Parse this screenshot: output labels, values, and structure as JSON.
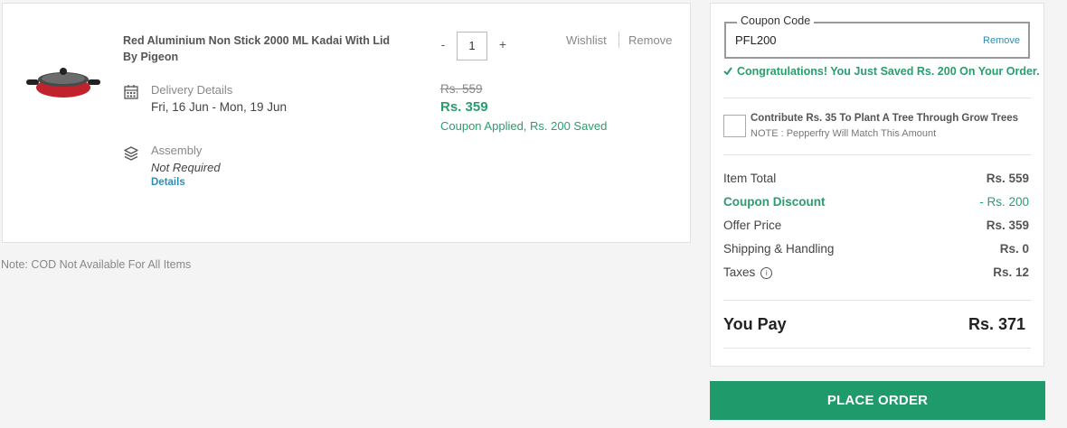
{
  "cart_item": {
    "name": "Red Aluminium Non Stick 2000 ML Kadai With Lid By Pigeon",
    "delivery_label": "Delivery Details",
    "delivery_value": "Fri, 16 Jun - Mon, 19 Jun",
    "assembly_label": "Assembly",
    "assembly_value": "Not Required",
    "assembly_link": "Details",
    "qty_minus": "-",
    "quantity": "1",
    "qty_plus": "+",
    "wishlist": "Wishlist",
    "remove": "Remove",
    "price_original": "Rs. 559",
    "price_final": "Rs. 359",
    "price_note": "Coupon Applied, Rs. 200 Saved",
    "product_colors": {
      "body": "#c0232b",
      "lid": "#3a3a3a",
      "handle": "#222222"
    }
  },
  "note": "Note: COD Not Available For All Items",
  "summary": {
    "coupon_legend": "Coupon Code",
    "coupon_value": "PFL200",
    "coupon_remove": "Remove",
    "coupon_message": "Congratulations! You Just Saved Rs. 200 On Your Order.",
    "tree_text": "Contribute Rs. 35 To Plant A Tree Through Grow Trees",
    "tree_note": "NOTE : Pepperfry Will Match This Amount",
    "rows": [
      {
        "label": "Item Total",
        "value": "Rs. 559"
      },
      {
        "label": "Coupon Discount",
        "value": "- Rs. 200"
      },
      {
        "label": "Offer Price",
        "value": "Rs. 359"
      },
      {
        "label": "Shipping & Handling",
        "value": "Rs. 0"
      },
      {
        "label": "Taxes",
        "value": "Rs. 12"
      }
    ],
    "pay_label": "You Pay",
    "pay_value": "Rs. 371",
    "info_icon": "i"
  },
  "place_order": "PLACE ORDER",
  "colors": {
    "accent_green": "#1e9a6b",
    "link_blue": "#2a8fb8",
    "success_text": "#2a9d6e"
  }
}
